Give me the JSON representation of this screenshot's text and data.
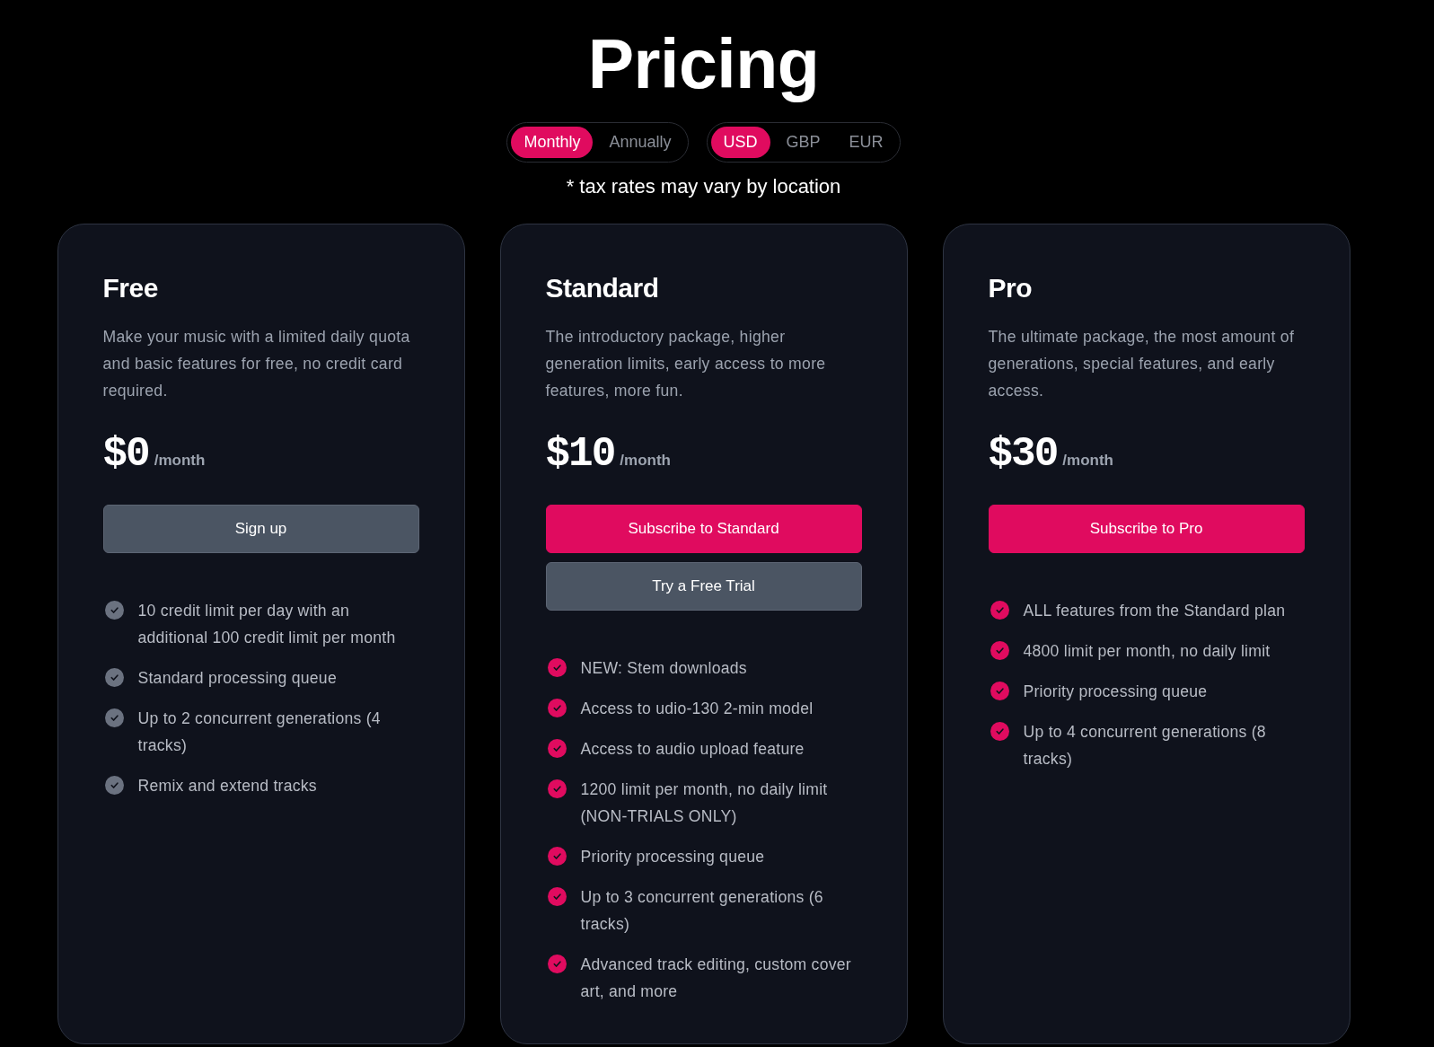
{
  "page_title": "Pricing",
  "billing_toggle": [
    {
      "label": "Monthly",
      "selected": true
    },
    {
      "label": "Annually",
      "selected": false
    }
  ],
  "currency_toggle": [
    {
      "label": "USD",
      "selected": true
    },
    {
      "label": "GBP",
      "selected": false
    },
    {
      "label": "EUR",
      "selected": false
    }
  ],
  "tax_note": "* tax rates may vary by location",
  "plans": [
    {
      "name": "Free",
      "description": "Make your music with a limited daily quota and basic features for free, no credit card required.",
      "price": "$0",
      "period": "/month",
      "color": "#6b7280",
      "buttons": [
        {
          "label": "Sign up",
          "kind": "secondary"
        }
      ],
      "features": [
        "10 credit limit per day with an additional 100 credit limit per month",
        "Standard processing queue",
        "Up to 2 concurrent generations (4 tracks)",
        "Remix and extend tracks"
      ]
    },
    {
      "name": "Standard",
      "description": "The introductory package, higher generation limits, early access to more features, more fun.",
      "price": "$10",
      "period": "/month",
      "color": "#e00b5f",
      "buttons": [
        {
          "label": "Subscribe to Standard",
          "kind": "primary"
        },
        {
          "label": "Try a Free Trial",
          "kind": "secondary"
        }
      ],
      "features": [
        "NEW: Stem downloads",
        "Access to udio-130 2-min model",
        "Access to audio upload feature",
        "1200 limit per month, no daily limit (NON-TRIALS ONLY)",
        "Priority processing queue",
        "Up to 3 concurrent generations (6 tracks)",
        "Advanced track editing, custom cover art, and more"
      ]
    },
    {
      "name": "Pro",
      "description": "The ultimate package, the most amount of generations, special features, and early access.",
      "price": "$30",
      "period": "/month",
      "color": "#e00b5f",
      "buttons": [
        {
          "label": "Subscribe to Pro",
          "kind": "primary"
        }
      ],
      "features": [
        "ALL features from the Standard plan",
        "4800 limit per month, no daily limit",
        "Priority processing queue",
        "Up to 4 concurrent generations (8 tracks)"
      ]
    }
  ]
}
